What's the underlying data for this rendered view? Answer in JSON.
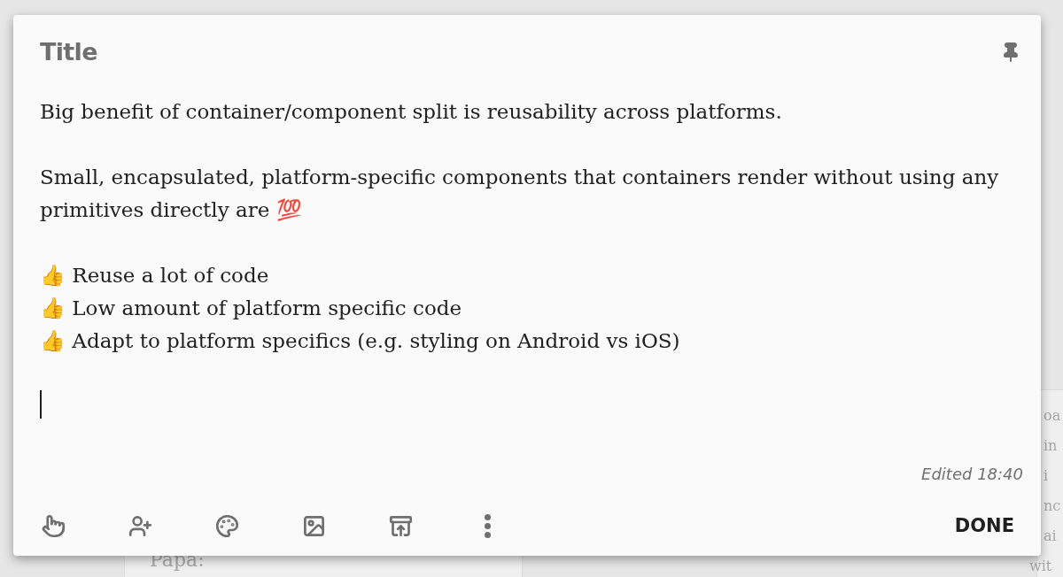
{
  "background": {
    "left_text": "Papa:",
    "right_text": [
      "oa",
      "in",
      "i",
      "nc",
      "ai",
      "wit"
    ]
  },
  "note": {
    "title": "Title",
    "pinned": false,
    "paragraphs": [
      [
        "Big benefit of container/component split is reusability across platforms."
      ],
      [
        "Small, encapsulated, platform-specific components that containers render without using any primitives directly are 💯"
      ],
      [
        "👍 Reuse a lot of code",
        "👍 Low amount of platform specific code",
        "👍 Adapt to platform specifics (e.g. styling on Android vs iOS)"
      ]
    ],
    "edited": "Edited 18:40",
    "toolbar": [
      {
        "kind": "reminder"
      },
      {
        "kind": "collaborator"
      },
      {
        "kind": "color"
      },
      {
        "kind": "image"
      },
      {
        "kind": "archive"
      },
      {
        "kind": "more"
      }
    ],
    "done": "DONE"
  }
}
